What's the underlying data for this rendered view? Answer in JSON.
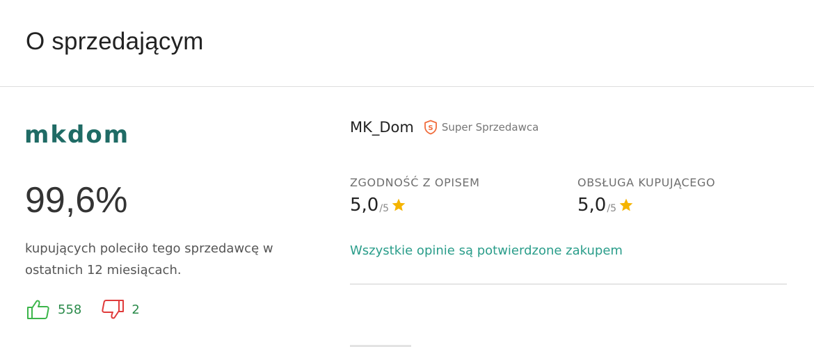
{
  "header": {
    "title": "O sprzedającym"
  },
  "seller": {
    "logo_text": "mkdom",
    "name": "MK_Dom",
    "badge_label": "Super Sprzedawca",
    "badge_icon": "super-seller-shield-icon",
    "badge_color": "#f06c3c"
  },
  "recommendation": {
    "percent": "99,6%",
    "description": "kupujących poleciło tego sprzedawcę w ostatnich 12 miesiącach.",
    "positive_count": "558",
    "negative_count": "2",
    "positive_icon": "thumb-up-icon",
    "negative_icon": "thumb-down-icon",
    "positive_color": "#3bb54a",
    "negative_color": "#e03b3b"
  },
  "ratings": [
    {
      "label": "ZGODNOŚĆ Z OPISEM",
      "value": "5,0",
      "max": "/5",
      "icon": "star-icon"
    },
    {
      "label": "OBSŁUGA KUPUJĄCEGO",
      "value": "5,0",
      "max": "/5",
      "icon": "star-icon"
    }
  ],
  "star_color": "#f5b400",
  "verified_text": "Wszystkie opinie są potwierdzone zakupem",
  "accent_color": "#2a9d8a"
}
